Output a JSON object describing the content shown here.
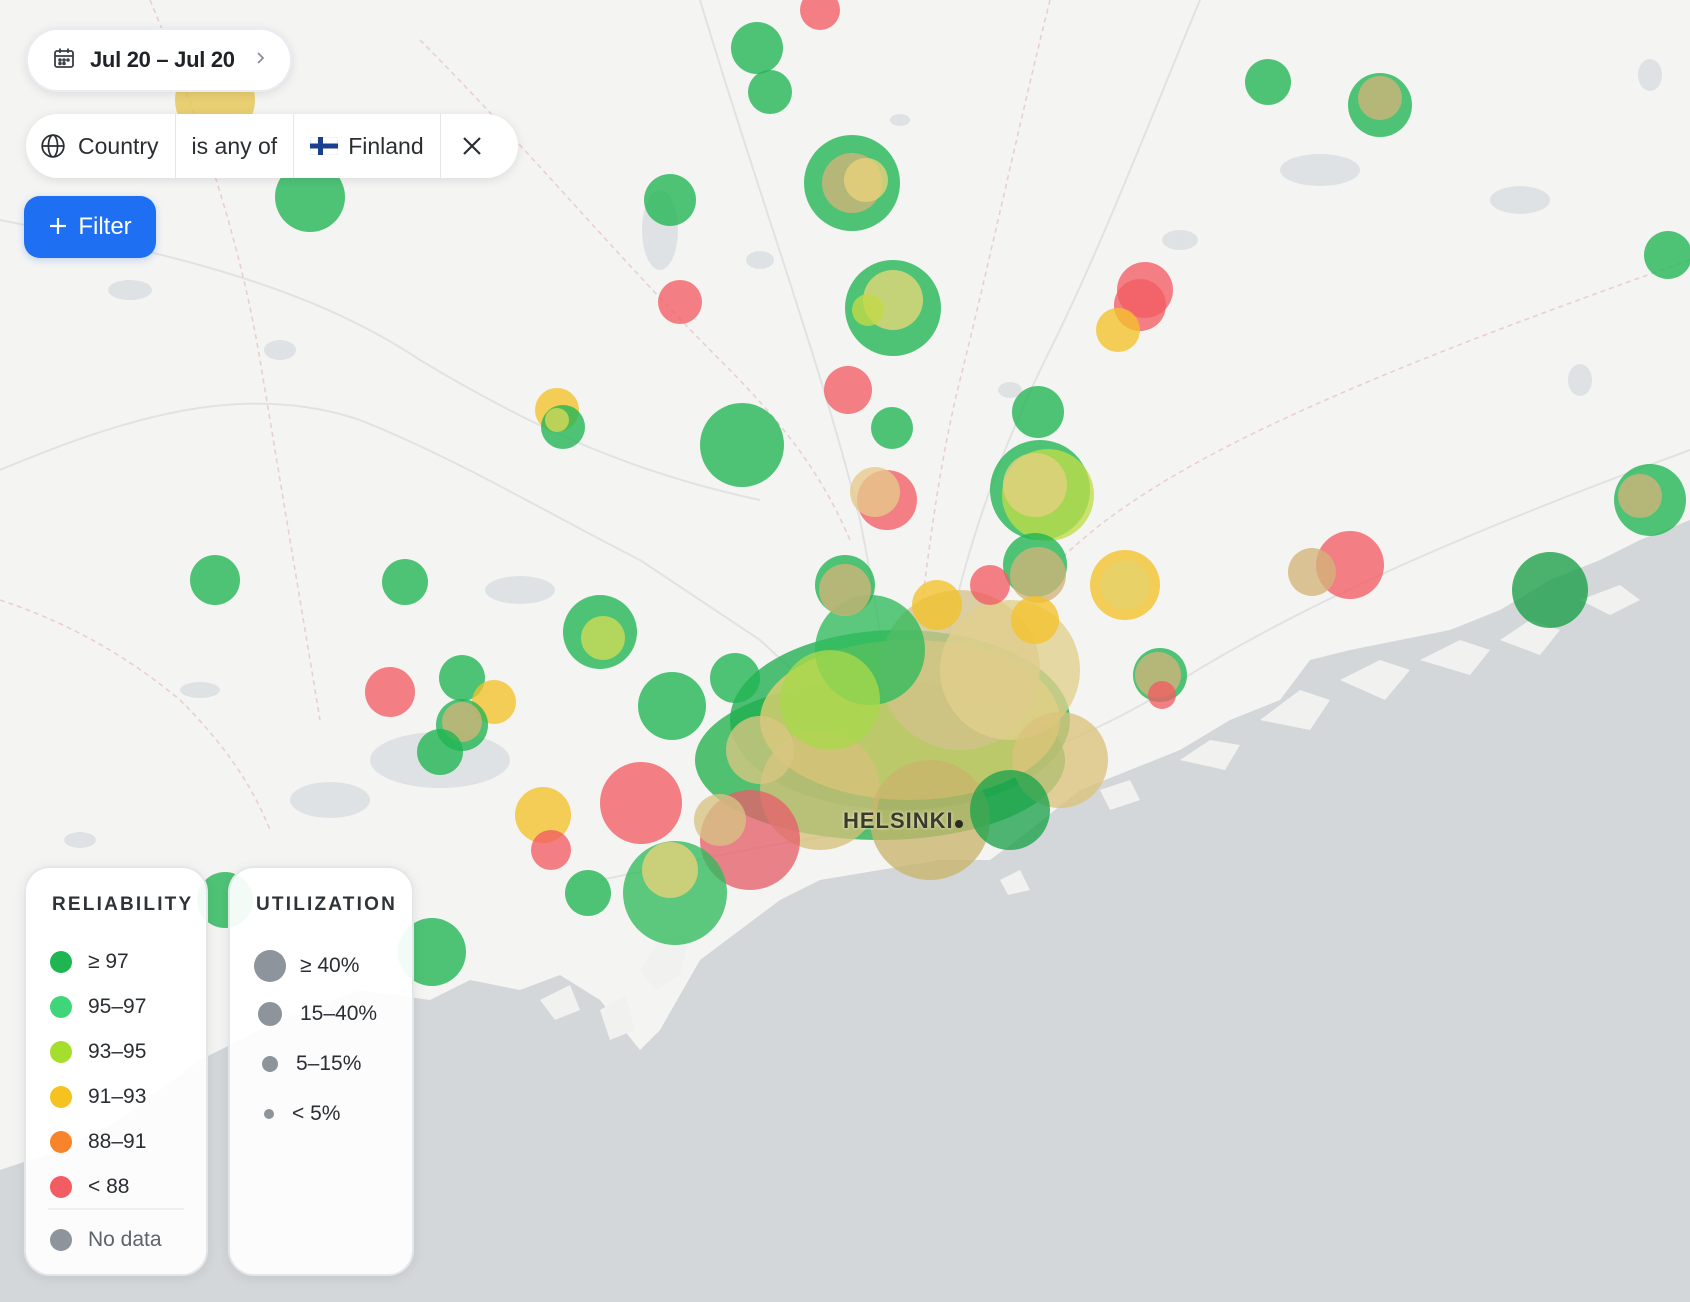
{
  "date_range": {
    "label": "Jul 20 – Jul 20",
    "calendar_icon": "calendar-icon",
    "chevron_icon": "chevron-right-icon"
  },
  "filter": {
    "field": "Country",
    "operator": "is any of",
    "value": "Finland",
    "field_icon": "globe-icon",
    "value_icon": "finland-flag-icon",
    "remove_icon": "close-icon"
  },
  "add_filter_button": {
    "label": "Filter",
    "icon": "plus-icon"
  },
  "map": {
    "city_label": "HELSINKI",
    "land_color": "#f4f4f3",
    "sea_color": "#d3d7da"
  },
  "legend": {
    "reliability": {
      "title": "RELIABILITY",
      "items": [
        {
          "label": "≥ 97",
          "color": "#1fb552"
        },
        {
          "label": "95–97",
          "color": "#3fd67a"
        },
        {
          "label": "93–95",
          "color": "#a6de2d"
        },
        {
          "label": "91–93",
          "color": "#f6c21f"
        },
        {
          "label": "88–91",
          "color": "#f7842b"
        },
        {
          "label": "< 88",
          "color": "#f25c63"
        }
      ],
      "no_data": {
        "label": "No data",
        "color": "#8e949b"
      }
    },
    "utilization": {
      "title": "UTILIZATION",
      "items": [
        {
          "label": "≥ 40%"
        },
        {
          "label": "15–40%"
        },
        {
          "label": "5–15%"
        },
        {
          "label": "< 5%"
        }
      ],
      "color": "#8e949b"
    }
  }
}
